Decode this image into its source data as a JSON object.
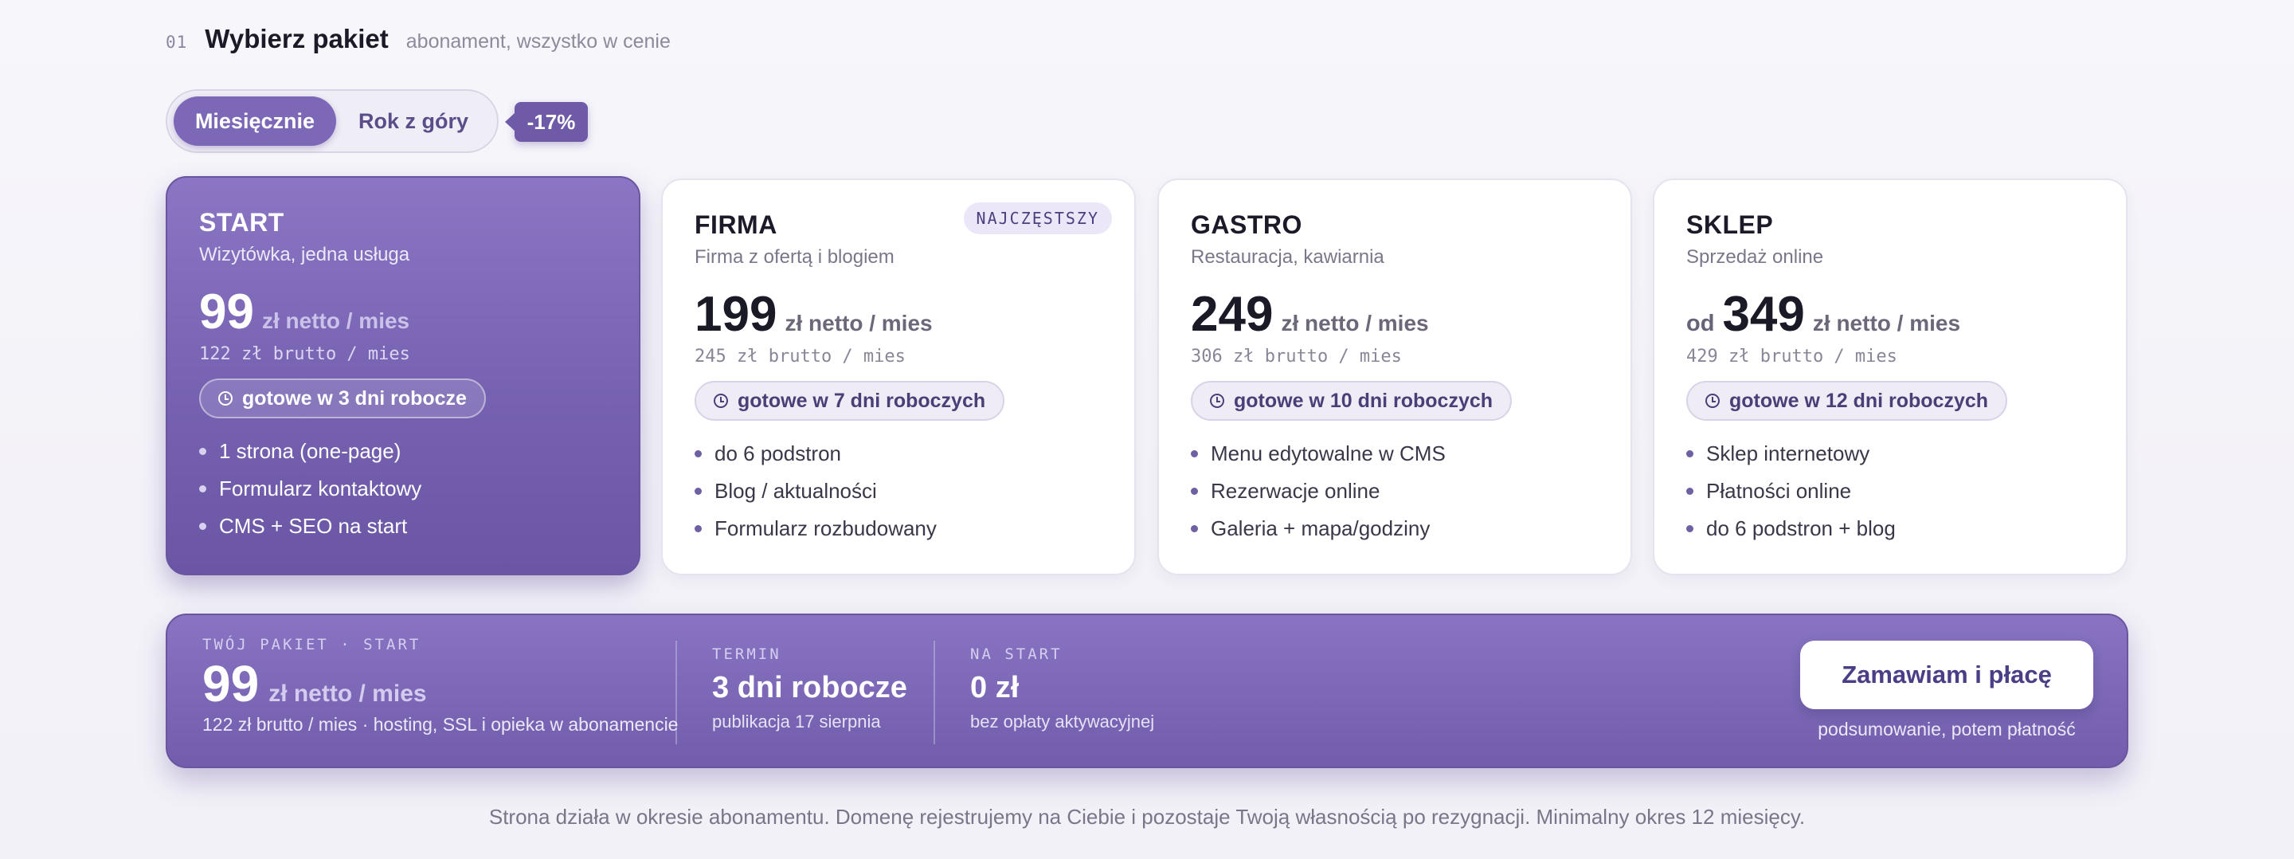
{
  "header": {
    "step": "01",
    "title": "Wybierz pakiet",
    "subtitle": "abonament, wszystko w cenie"
  },
  "billing": {
    "options": [
      "Miesięcznie",
      "Rok z góry"
    ],
    "selected": "Miesięcznie",
    "discount": "-17%"
  },
  "plans": [
    {
      "name": "START",
      "description": "Wizytówka, jedna usługa",
      "price_prefix": "",
      "price": "99",
      "price_unit": "zł netto / mies",
      "gross": "122 zł brutto / mies",
      "ready": "gotowe w 3 dni robocze",
      "features": [
        "1 strona (one-page)",
        "Formularz kontaktowy",
        "CMS + SEO na start"
      ],
      "selected": true
    },
    {
      "name": "FIRMA",
      "description": "Firma z ofertą i blogiem",
      "badge": "NAJCZĘSTSZY",
      "price_prefix": "",
      "price": "199",
      "price_unit": "zł netto / mies",
      "gross": "245 zł brutto / mies",
      "ready": "gotowe w 7 dni roboczych",
      "features": [
        "do 6 podstron",
        "Blog / aktualności",
        "Formularz rozbudowany"
      ],
      "selected": false
    },
    {
      "name": "GASTRO",
      "description": "Restauracja, kawiarnia",
      "price_prefix": "",
      "price": "249",
      "price_unit": "zł netto / mies",
      "gross": "306 zł brutto / mies",
      "ready": "gotowe w 10 dni roboczych",
      "features": [
        "Menu edytowalne w CMS",
        "Rezerwacje online",
        "Galeria + mapa/godziny"
      ],
      "selected": false
    },
    {
      "name": "SKLEP",
      "description": "Sprzedaż online",
      "price_prefix": "od",
      "price": "349",
      "price_unit": "zł netto / mies",
      "gross": "429 zł brutto / mies",
      "ready": "gotowe w 12 dni roboczych",
      "features": [
        "Sklep internetowy",
        "Płatności online",
        "do 6 podstron + blog"
      ],
      "selected": false
    }
  ],
  "summary": {
    "package_label": "TWÓJ PAKIET · START",
    "price": "99",
    "price_unit": "zł netto / mies",
    "note": "122 zł brutto / mies · hosting, SSL i opieka w abonamencie",
    "term_label": "TERMIN",
    "term_value": "3 dni robocze",
    "term_sub": "publikacja 17 sierpnia",
    "start_label": "NA START",
    "start_value": "0 zł",
    "start_sub": "bez opłaty aktywacyjnej",
    "order_button": "Zamawiam i płacę",
    "order_sub": "podsumowanie, potem płatność"
  },
  "footnote": "Strona działa w okresie abonamentu. Domenę rejestrujemy na Ciebie i pozostaje Twoją własnością po rezygnacji. Minimalny okres 12 miesięcy.",
  "colors": {
    "accent": "#7d68b8",
    "accent_dark": "#6f5aa8",
    "background": "#f5f4f9"
  },
  "icons": {
    "ready": "clock-icon",
    "feature": "bullet-dot"
  }
}
